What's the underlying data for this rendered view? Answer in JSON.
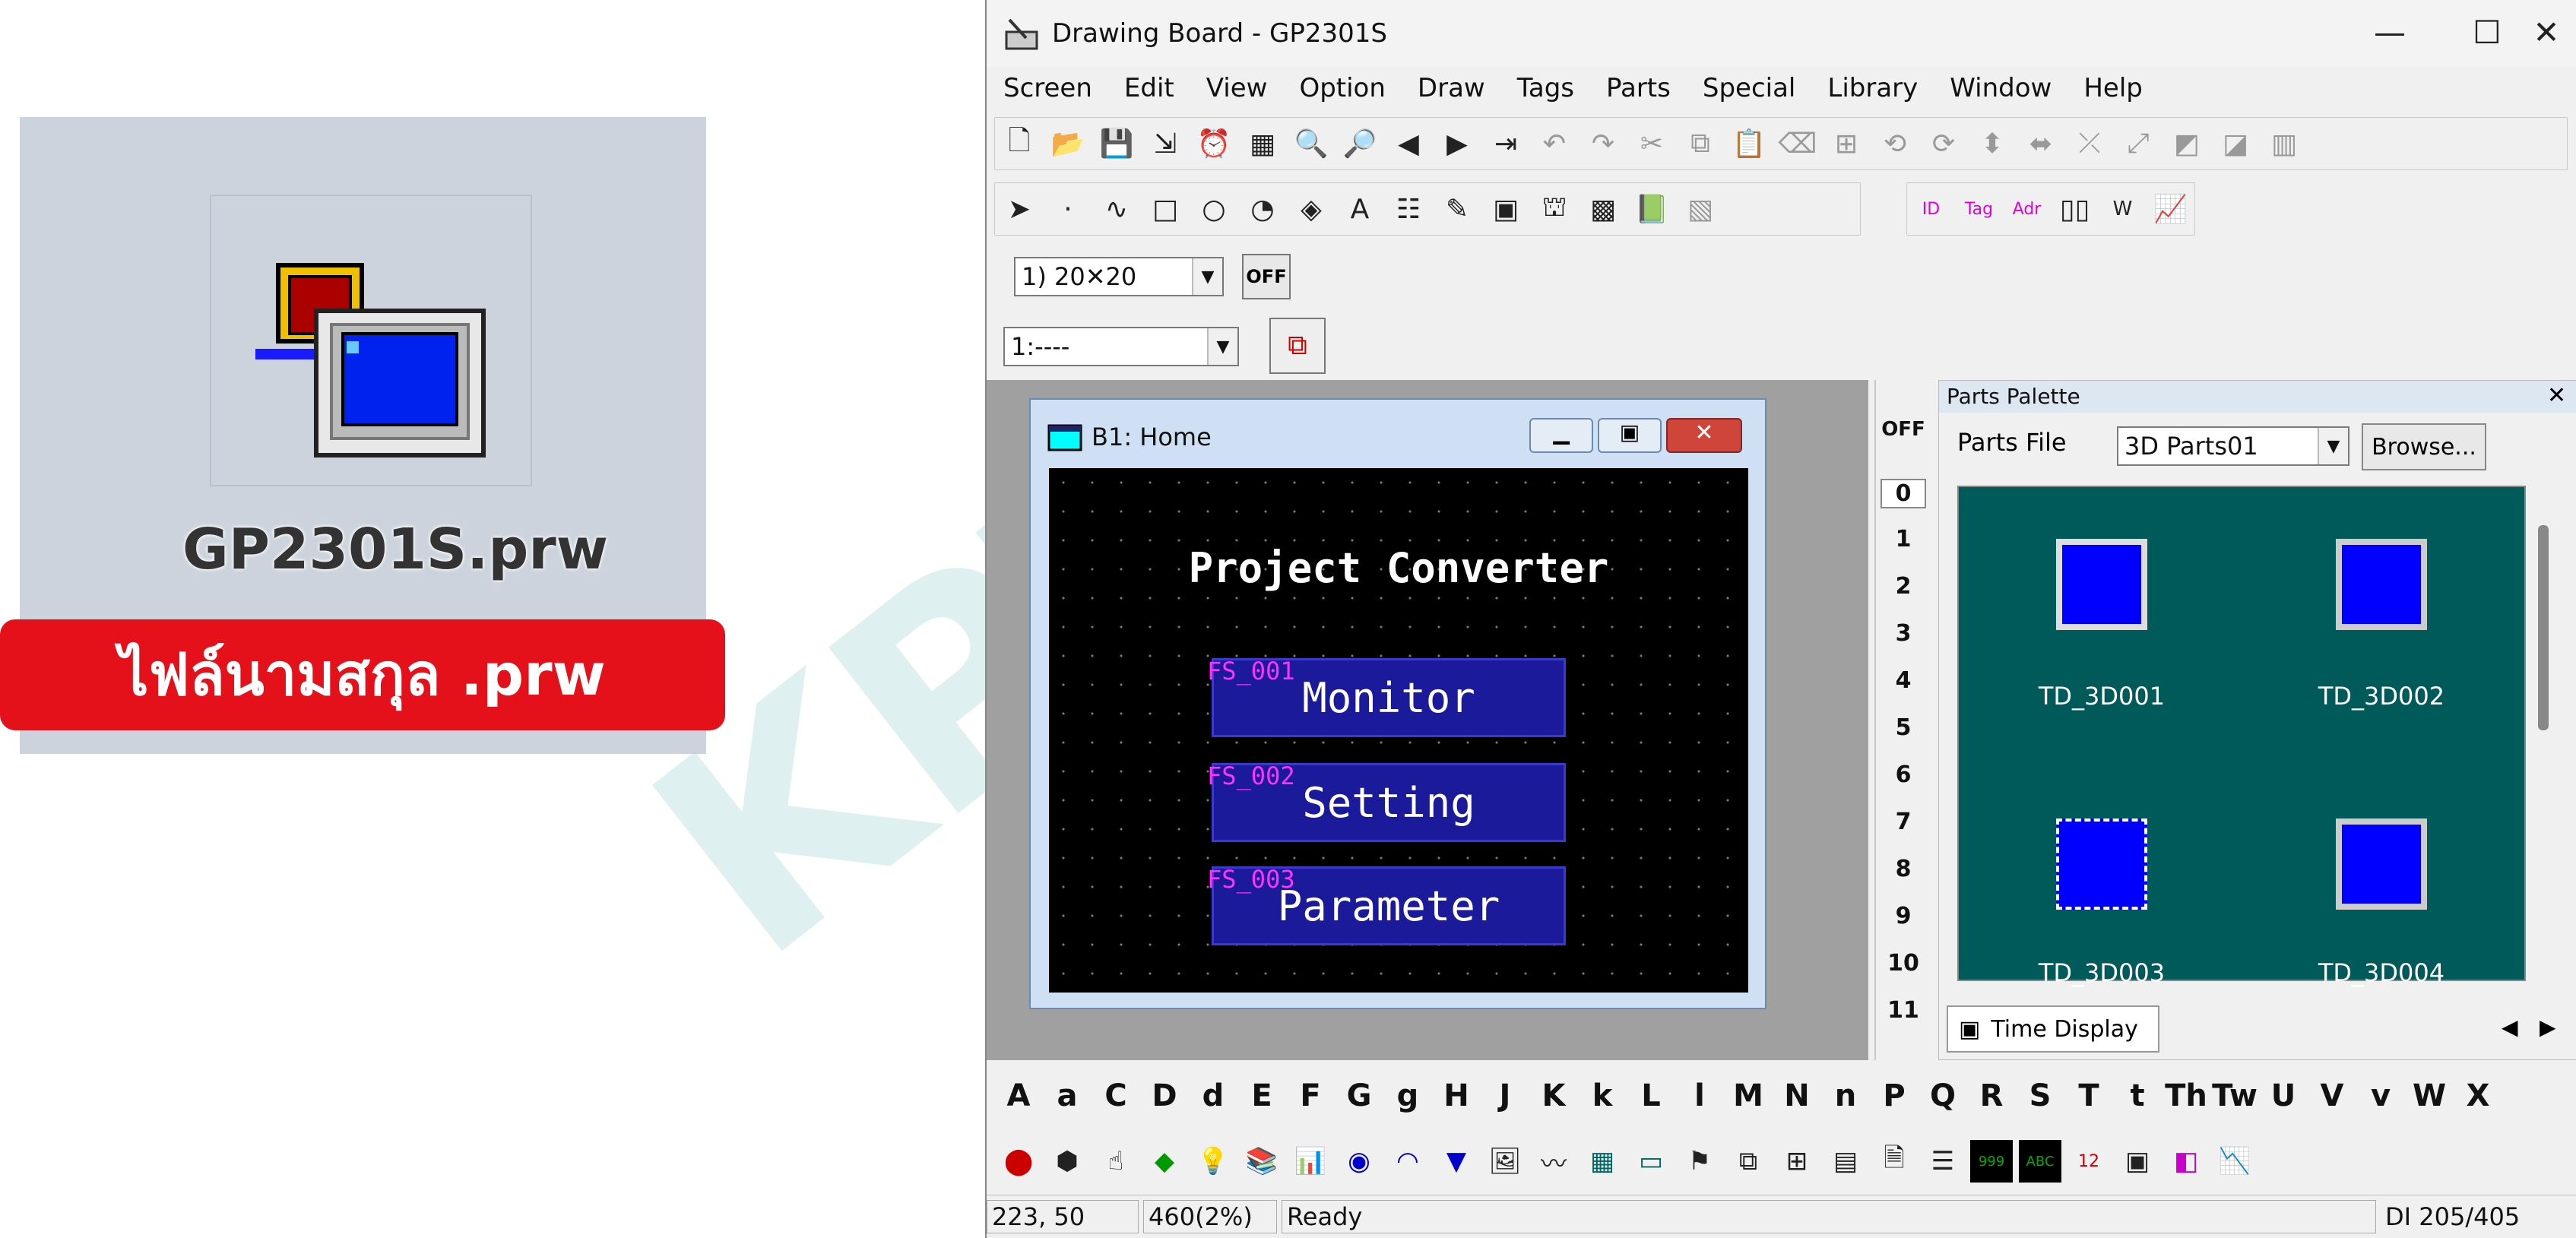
{
  "file": {
    "name": "GP2301S.prw",
    "label": "ไฟล์นามสกุล .prw"
  },
  "window": {
    "title": "Drawing Board - GP2301S",
    "minimize": "—",
    "maximize": "☐",
    "close": "✕"
  },
  "menu": [
    "Screen",
    "Edit",
    "View",
    "Option",
    "Draw",
    "Tags",
    "Parts",
    "Special",
    "Library",
    "Window",
    "Help"
  ],
  "toolbar": {
    "grid_select": "1) 20✕20",
    "off_label": "OFF",
    "layer_select": "1:----"
  },
  "child_window": {
    "title": "B1: Home",
    "header": "Project Converter",
    "buttons": [
      {
        "tag": "FS_001",
        "label": "Monitor"
      },
      {
        "tag": "FS_002",
        "label": "Setting"
      },
      {
        "tag": "FS_003",
        "label": "Parameter"
      }
    ]
  },
  "ruler": {
    "off": "OFF",
    "numbers": [
      "0",
      "1",
      "2",
      "3",
      "4",
      "5",
      "6",
      "7",
      "8",
      "9",
      "10",
      "11"
    ]
  },
  "palette": {
    "title": "Parts Palette",
    "file_label": "Parts File",
    "file_value": "3D Parts01",
    "browse": "Browse...",
    "parts": [
      "TD_3D001",
      "TD_3D002",
      "TD_3D003",
      "TD_3D004"
    ],
    "tab": "Time Display"
  },
  "char_bar": [
    "A",
    "a",
    "C",
    "D",
    "d",
    "E",
    "F",
    "G",
    "g",
    "H",
    "J",
    "K",
    "k",
    "L",
    "l",
    "M",
    "N",
    "n",
    "P",
    "Q",
    "R",
    "S",
    "T",
    "t",
    "Th",
    "Tw",
    "U",
    "V",
    "v",
    "W",
    "X"
  ],
  "status": {
    "coords": "223, 50",
    "mem": "460(2%)",
    "state": "Ready",
    "count": "DI 205/405"
  },
  "watermark": "KPT"
}
